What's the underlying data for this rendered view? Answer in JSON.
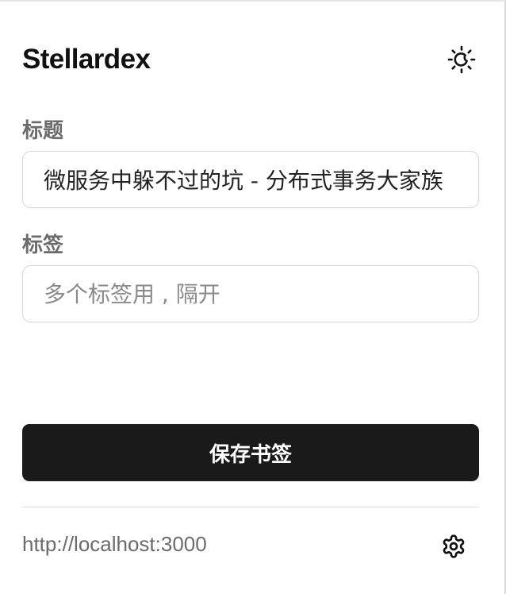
{
  "header": {
    "app_title": "Stellardex",
    "theme_toggle_icon": "sun-moon-icon"
  },
  "form": {
    "title_label": "标题",
    "title_value": "微服务中躲不过的坑 - 分布式事务大家族",
    "tags_label": "标签",
    "tags_value": "",
    "tags_placeholder": "多个标签用 , 隔开"
  },
  "actions": {
    "save_label": "保存书签"
  },
  "footer": {
    "server_url": "http://localhost:3000",
    "settings_icon": "gear-icon"
  },
  "colors": {
    "primary_button": "#1a1a1a",
    "label_text": "#6b6b6b",
    "border": "#d8d8d8"
  }
}
